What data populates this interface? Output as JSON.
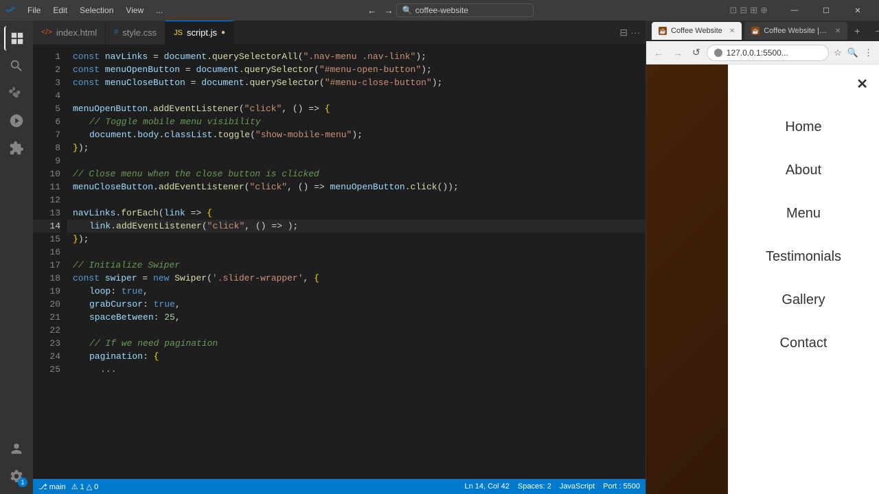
{
  "titlebar": {
    "menu_items": [
      "File",
      "Edit",
      "Selection",
      "View",
      "..."
    ],
    "search_placeholder": "coffee-website",
    "win_controls": [
      "—",
      "☐",
      "✕"
    ]
  },
  "tabs": [
    {
      "id": "index-html",
      "icon": "html",
      "label": "index.html",
      "active": false,
      "modified": false
    },
    {
      "id": "style-css",
      "icon": "css",
      "label": "style.css",
      "active": false,
      "modified": false
    },
    {
      "id": "script-js",
      "icon": "js",
      "label": "script.js",
      "active": true,
      "modified": true
    }
  ],
  "code": {
    "lines": [
      {
        "num": 1,
        "text": "const navLinks = document.querySelectorAll(\".nav-menu .nav-link\");"
      },
      {
        "num": 2,
        "text": "const menuOpenButton = document.querySelector(\"#menu-open-button\");"
      },
      {
        "num": 3,
        "text": "const menuCloseButton = document.querySelector(\"#menu-close-button\");"
      },
      {
        "num": 4,
        "text": ""
      },
      {
        "num": 5,
        "text": "menuOpenButton.addEventListener(\"click\", () => {"
      },
      {
        "num": 6,
        "text": "    // Toggle mobile menu visibility"
      },
      {
        "num": 7,
        "text": "    document.body.classList.toggle(\"show-mobile-menu\");"
      },
      {
        "num": 8,
        "text": "});"
      },
      {
        "num": 9,
        "text": ""
      },
      {
        "num": 10,
        "text": "// Close menu when the close button is clicked"
      },
      {
        "num": 11,
        "text": "menuCloseButton.addEventListener(\"click\", () => menuOpenButton.click());"
      },
      {
        "num": 12,
        "text": ""
      },
      {
        "num": 13,
        "text": "navLinks.forEach(link => {"
      },
      {
        "num": 14,
        "text": "    link.addEventListener(\"click\", () => );"
      },
      {
        "num": 15,
        "text": "});"
      },
      {
        "num": 16,
        "text": ""
      },
      {
        "num": 17,
        "text": "// Initialize Swiper"
      },
      {
        "num": 18,
        "text": "const swiper = new Swiper('.slider-wrapper', {"
      },
      {
        "num": 19,
        "text": "    loop: true,"
      },
      {
        "num": 20,
        "text": "    grabCursor: true,"
      },
      {
        "num": 21,
        "text": "    spaceBetween: 25,"
      },
      {
        "num": 22,
        "text": ""
      },
      {
        "num": 23,
        "text": "    // If we need pagination"
      },
      {
        "num": 24,
        "text": "    pagination: {"
      },
      {
        "num": 25,
        "text": "        ..."
      }
    ],
    "active_line": 14
  },
  "statusbar": {
    "left": [
      "⚠ 1 △ 0",
      "main"
    ],
    "right": [
      "Ln 14, Col 42",
      "Spaces: 2",
      "JavaScript",
      "Port : 5500"
    ]
  },
  "browser": {
    "tabs": [
      {
        "id": "coffee-website-1",
        "label": "Coffee Website",
        "active": true
      },
      {
        "id": "coffee-website-2",
        "label": "Coffee Website | C...",
        "active": false
      }
    ],
    "url": "127.0.0.1:5500...",
    "nav_links": [
      "Home",
      "About",
      "Menu",
      "Testimonials",
      "Gallery",
      "Contact"
    ],
    "close_label": "✕"
  }
}
